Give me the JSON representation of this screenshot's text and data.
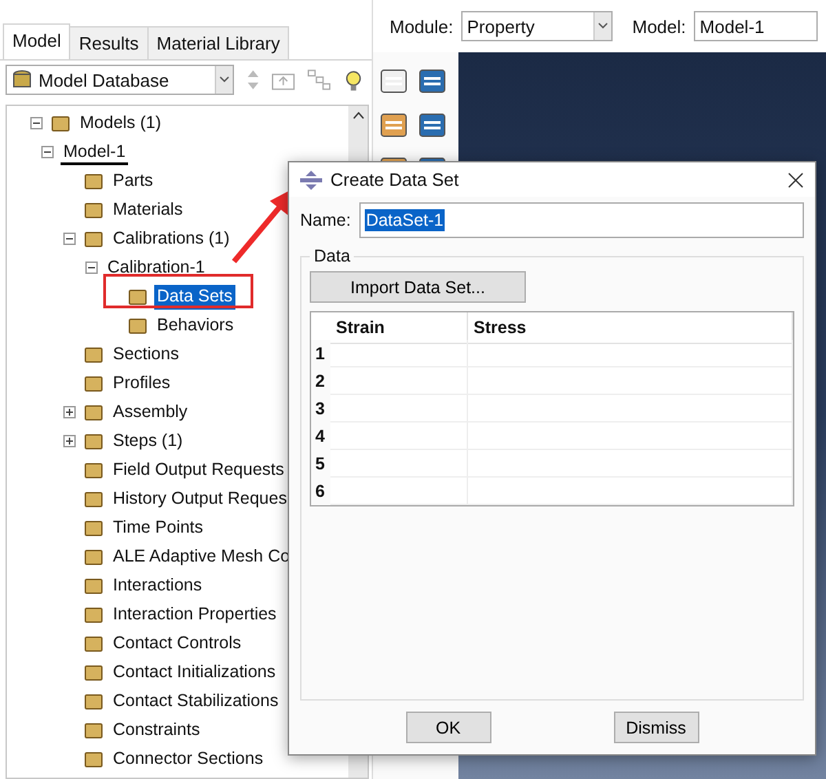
{
  "tabs": [
    {
      "label": "Model",
      "selected": true
    },
    {
      "label": "Results",
      "selected": false
    },
    {
      "label": "Material Library",
      "selected": false
    }
  ],
  "database_selector": {
    "value": "Model Database"
  },
  "tree": [
    {
      "label": "Models (1)",
      "expanded": true,
      "selected": false,
      "current": false,
      "children": [
        {
          "label": "Model-1",
          "expanded": true,
          "selected": false,
          "current": true,
          "children": [
            {
              "label": "Parts",
              "selected": false,
              "current": false
            },
            {
              "label": "Materials",
              "selected": false,
              "current": false
            },
            {
              "label": "Calibrations (1)",
              "expanded": true,
              "selected": false,
              "current": false,
              "children": [
                {
                  "label": "Calibration-1",
                  "expanded": true,
                  "selected": false,
                  "current": false,
                  "children": [
                    {
                      "label": "Data Sets",
                      "selected": true,
                      "current": false
                    },
                    {
                      "label": "Behaviors",
                      "selected": false,
                      "current": false
                    }
                  ]
                }
              ]
            },
            {
              "label": "Sections",
              "selected": false,
              "current": false
            },
            {
              "label": "Profiles",
              "selected": false,
              "current": false
            },
            {
              "label": "Assembly",
              "expanded": false,
              "selected": false,
              "current": false
            },
            {
              "label": "Steps (1)",
              "expanded": false,
              "selected": false,
              "current": false
            },
            {
              "label": "Field Output Requests",
              "selected": false,
              "current": false
            },
            {
              "label": "History Output Reques",
              "selected": false,
              "current": false
            },
            {
              "label": "Time Points",
              "selected": false,
              "current": false
            },
            {
              "label": "ALE Adaptive Mesh Co",
              "selected": false,
              "current": false
            },
            {
              "label": "Interactions",
              "selected": false,
              "current": false
            },
            {
              "label": "Interaction Properties",
              "selected": false,
              "current": false
            },
            {
              "label": "Contact Controls",
              "selected": false,
              "current": false
            },
            {
              "label": "Contact Initializations",
              "selected": false,
              "current": false
            },
            {
              "label": "Contact Stabilizations",
              "selected": false,
              "current": false
            },
            {
              "label": "Constraints",
              "selected": false,
              "current": false
            },
            {
              "label": "Connector Sections",
              "selected": false,
              "current": false
            }
          ]
        }
      ]
    }
  ],
  "module_bar": {
    "module_label": "Module:",
    "module_value": "Property",
    "model_label": "Model:",
    "model_value": "Model-1"
  },
  "dialog": {
    "title": "Create Data Set",
    "name_label": "Name:",
    "name_value": "DataSet-1",
    "group_title": "Data",
    "import_button": "Import Data Set...",
    "columns": [
      "Strain",
      "Stress"
    ],
    "row_numbers": [
      "1",
      "2",
      "3",
      "4",
      "5",
      "6"
    ],
    "buttons": [
      "OK",
      "Dismiss"
    ]
  }
}
